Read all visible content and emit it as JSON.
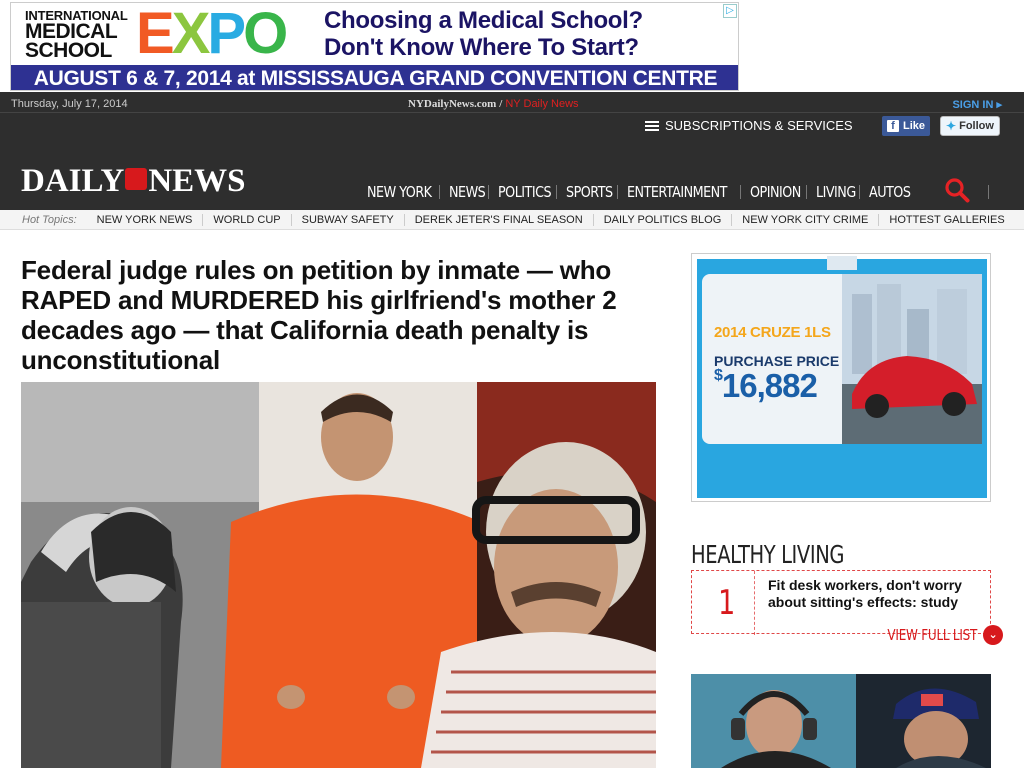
{
  "ad_banner": {
    "line1": "INTERNATIONAL",
    "line2": "MEDICAL",
    "line3": "SCHOOL",
    "expo": "EXPO",
    "headline_1": "Choosing a Medical School?",
    "headline_2": "Don't Know Where To Start?",
    "dates": "AUGUST 6 & 7, 2014 at MISSISSAUGA GRAND CONVENTION CENTRE",
    "choice_glyph": "▷"
  },
  "header": {
    "date": "Thursday, July 17, 2014",
    "site_url": "NYDailyNews.com",
    "site_sep": "/",
    "site_link": "NY Daily News",
    "sign_in": "SIGN IN ▸",
    "subscriptions": "SUBSCRIPTIONS & SERVICES",
    "fb_label": "Like",
    "tw_label": "Follow",
    "logo_left": "DAILY",
    "logo_right": "NEWS"
  },
  "nav": {
    "items": [
      "NEW YORK",
      "NEWS",
      "POLITICS",
      "SPORTS",
      "ENTERTAINMENT",
      "OPINION",
      "LIVING",
      "AUTOS"
    ]
  },
  "hot_topics": {
    "label": "Hot Topics:",
    "items": [
      "NEW YORK NEWS",
      "WORLD CUP",
      "SUBWAY SAFETY",
      "DEREK JETER'S FINAL SEASON",
      "DAILY POLITICS BLOG",
      "NEW YORK CITY CRIME",
      "HOTTEST GALLERIES"
    ]
  },
  "article": {
    "headline": "Federal judge rules on petition by inmate — who RAPED and MURDERED his girlfriend's mother 2 decades ago — that California death penalty is unconstitutional"
  },
  "side_ad": {
    "model": "2014 CRUZE 1LS",
    "price_label": "PURCHASE PRICE",
    "price": "16,882",
    "currency": "$"
  },
  "healthy_living": {
    "title": "HEALTHY LIVING",
    "rank": "1",
    "story": "Fit desk workers, don't worry about sitting's effects: study",
    "view_full": "VIEW FULL LIST",
    "chevron": "⌄"
  },
  "colors": {
    "brand_red": "#d7191c",
    "header_dark": "#2e2e2e",
    "ad_navy": "#2e3192",
    "link_blue": "#4a9fe8"
  }
}
